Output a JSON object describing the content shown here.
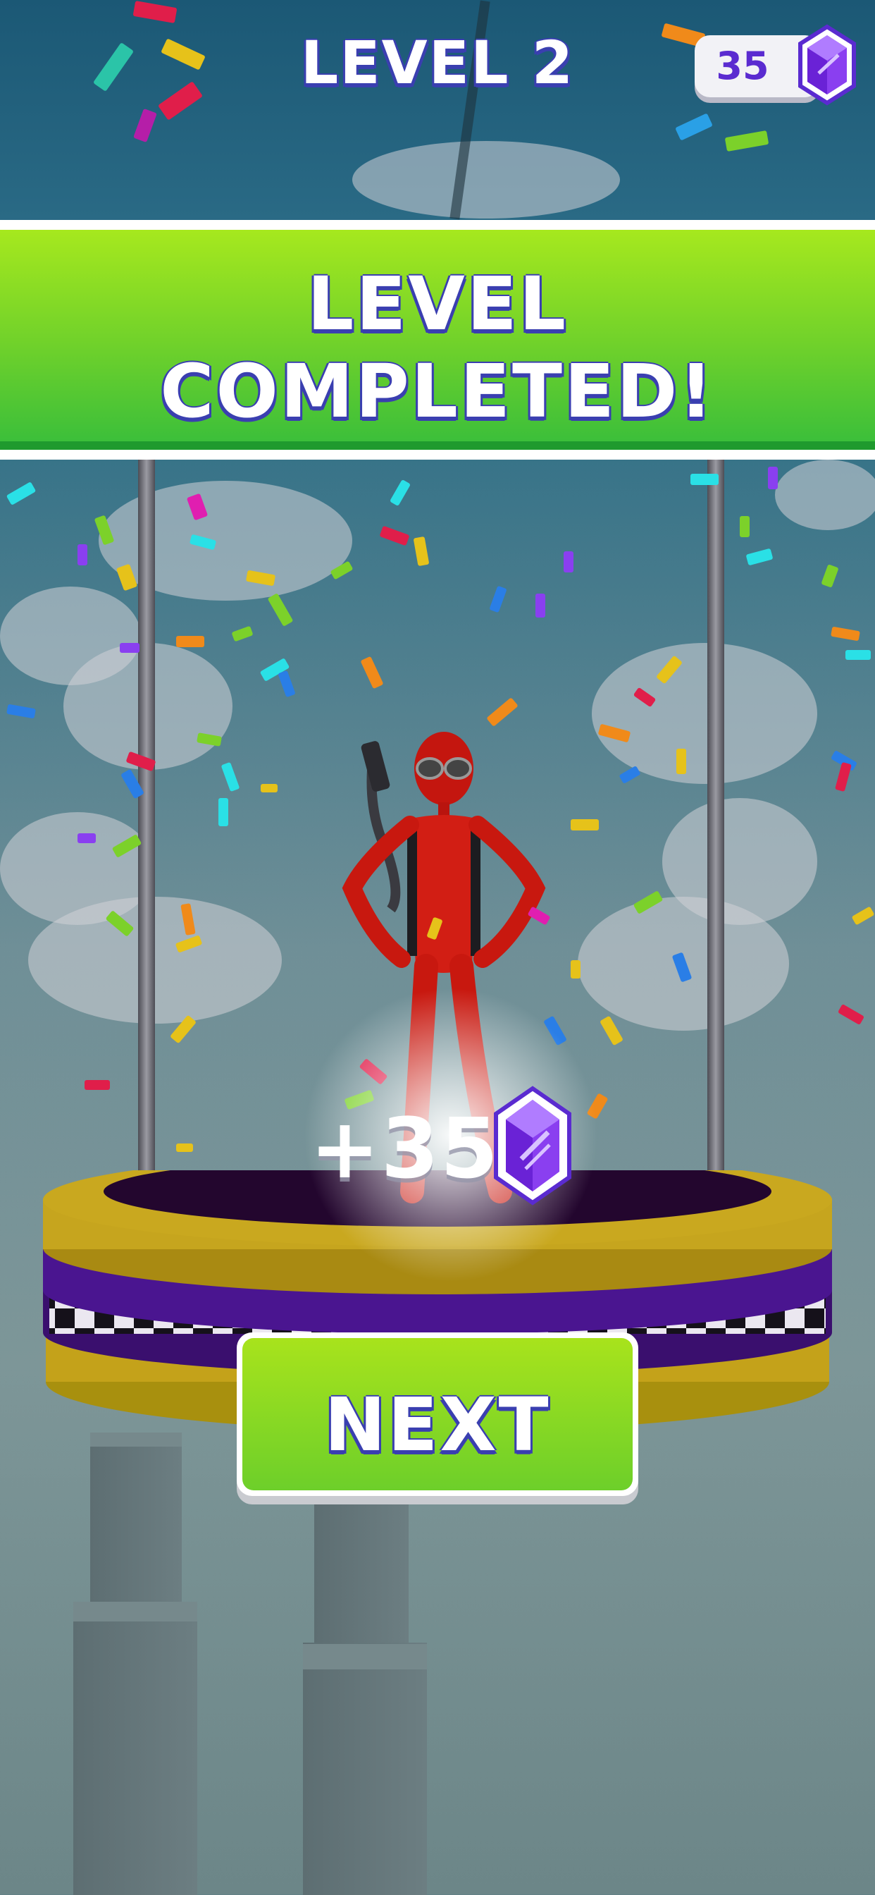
{
  "header": {
    "level_label": "LEVEL 2"
  },
  "currency": {
    "gem_count": "35",
    "icon": "purple-gem-icon"
  },
  "banner": {
    "line1": "LEVEL",
    "line2": "COMPLETED!"
  },
  "reward": {
    "amount_text": "+35",
    "icon": "purple-gem-icon"
  },
  "next_button": {
    "label": "NEXT"
  },
  "colors": {
    "banner_green": "#6fd12b",
    "gem_purple": "#8a3ff0",
    "outline_blue": "#3a3fb0",
    "character_red": "#d21e14"
  }
}
